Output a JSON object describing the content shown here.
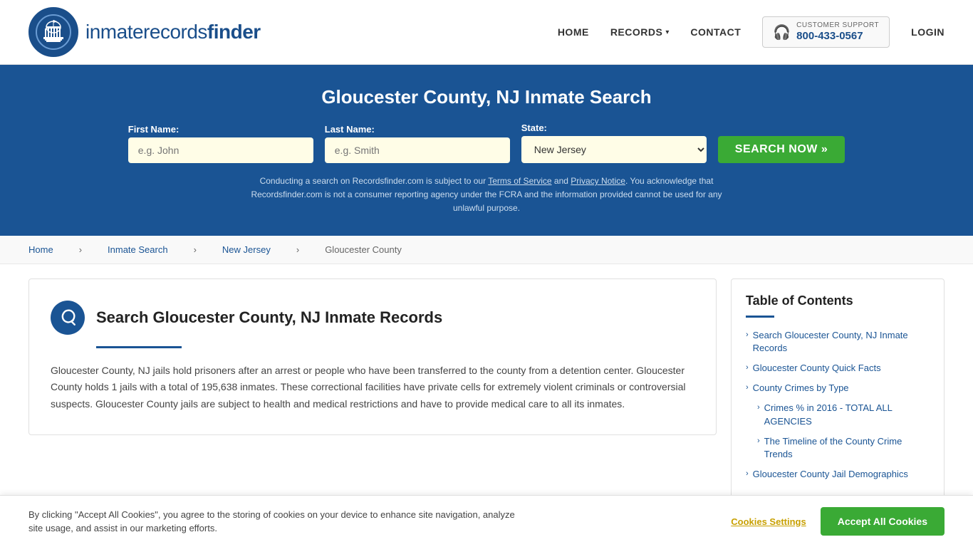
{
  "header": {
    "logo_text_main": "inmaterecords",
    "logo_text_bold": "finder",
    "nav": {
      "home": "HOME",
      "records": "RECORDS",
      "contact": "CONTACT",
      "login": "LOGIN"
    },
    "support": {
      "label": "CUSTOMER SUPPORT",
      "number": "800-433-0567"
    }
  },
  "hero": {
    "title": "Gloucester County, NJ Inmate Search",
    "form": {
      "first_name_label": "First Name:",
      "first_name_placeholder": "e.g. John",
      "last_name_label": "Last Name:",
      "last_name_placeholder": "e.g. Smith",
      "state_label": "State:",
      "state_value": "New Jersey",
      "search_button": "SEARCH NOW »"
    },
    "disclaimer": "Conducting a search on Recordsfinder.com is subject to our Terms of Service and Privacy Notice. You acknowledge that Recordsfinder.com is not a consumer reporting agency under the FCRA and the information provided cannot be used for any unlawful purpose."
  },
  "breadcrumb": {
    "home": "Home",
    "inmate_search": "Inmate Search",
    "new_jersey": "New Jersey",
    "current": "Gloucester County"
  },
  "main": {
    "section_title": "Search Gloucester County, NJ Inmate Records",
    "body_text": "Gloucester County, NJ jails hold prisoners after an arrest or people who have been transferred to the county from a detention center. Gloucester County holds 1 jails with a total of 195,638 inmates. These correctional facilities have private cells for extremely violent criminals or controversial suspects. Gloucester County jails are subject to health and medical restrictions and have to provide medical care to all its inmates."
  },
  "toc": {
    "title": "Table of Contents",
    "items": [
      {
        "label": "Search Gloucester County, NJ Inmate Records",
        "sub": false
      },
      {
        "label": "Gloucester County Quick Facts",
        "sub": false
      },
      {
        "label": "County Crimes by Type",
        "sub": false
      },
      {
        "label": "Crimes % in 2016 - TOTAL ALL AGENCIES",
        "sub": true
      },
      {
        "label": "The Timeline of the County Crime Trends",
        "sub": true
      },
      {
        "label": "Gloucester County Jail Demographics",
        "sub": false
      }
    ]
  },
  "cookie_banner": {
    "text": "By clicking \"Accept All Cookies\", you agree to the storing of cookies on your device to enhance site navigation, analyze site usage, and assist in our marketing efforts.",
    "settings_label": "Cookies Settings",
    "accept_label": "Accept All Cookies"
  }
}
